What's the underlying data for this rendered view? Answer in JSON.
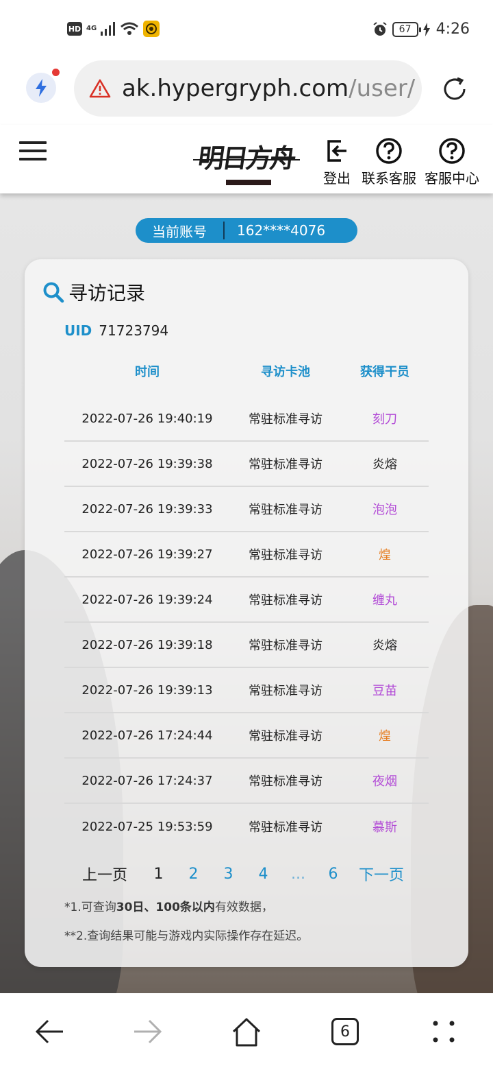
{
  "status_bar": {
    "hd": "HD",
    "network": "4G",
    "battery": "67",
    "time": "4:26"
  },
  "browser": {
    "url_host": "ak.hypergryph.com",
    "url_path": "/user/",
    "tab_count": "6"
  },
  "header": {
    "logo_text": "明日方舟",
    "logout_label": "登出",
    "contact_label": "联系客服",
    "help_center_label": "客服中心"
  },
  "account": {
    "label": "当前账号",
    "value": "162****4076"
  },
  "card": {
    "title": "寻访记录",
    "uid_label": "UID",
    "uid_value": "71723794"
  },
  "table": {
    "headers": [
      "时间",
      "寻访卡池",
      "获得干员"
    ],
    "rows": [
      {
        "time": "2022-07-26 19:40:19",
        "pool": "常驻标准寻访",
        "operator": "刻刀",
        "color": "#b24ad6"
      },
      {
        "time": "2022-07-26 19:39:38",
        "pool": "常驻标准寻访",
        "operator": "炎熔",
        "color": "#222222"
      },
      {
        "time": "2022-07-26 19:39:33",
        "pool": "常驻标准寻访",
        "operator": "泡泡",
        "color": "#b24ad6"
      },
      {
        "time": "2022-07-26 19:39:27",
        "pool": "常驻标准寻访",
        "operator": "煌",
        "color": "#e67e22"
      },
      {
        "time": "2022-07-26 19:39:24",
        "pool": "常驻标准寻访",
        "operator": "缠丸",
        "color": "#b24ad6"
      },
      {
        "time": "2022-07-26 19:39:18",
        "pool": "常驻标准寻访",
        "operator": "炎熔",
        "color": "#222222"
      },
      {
        "time": "2022-07-26 19:39:13",
        "pool": "常驻标准寻访",
        "operator": "豆苗",
        "color": "#b24ad6"
      },
      {
        "time": "2022-07-26 17:24:44",
        "pool": "常驻标准寻访",
        "operator": "煌",
        "color": "#e67e22"
      },
      {
        "time": "2022-07-26 17:24:37",
        "pool": "常驻标准寻访",
        "operator": "夜烟",
        "color": "#b24ad6"
      },
      {
        "time": "2022-07-25 19:53:59",
        "pool": "常驻标准寻访",
        "operator": "慕斯",
        "color": "#b24ad6"
      }
    ]
  },
  "pagination": {
    "prev": "上一页",
    "pages": [
      "1",
      "2",
      "3",
      "4",
      "...",
      "6"
    ],
    "current": "1",
    "next": "下一页"
  },
  "notes": {
    "n1_prefix": "*1.可查询",
    "n1_bold1": "30日",
    "n1_sep": "、",
    "n1_bold2": "100条以内",
    "n1_suffix": "有效数据，",
    "n2": "**2.查询结果可能与游戏内实际操作存在延迟。"
  },
  "colors": {
    "accent": "#1d8fca",
    "rarity_5": "#e67e22",
    "rarity_4": "#b24ad6",
    "rarity_3": "#222222"
  }
}
